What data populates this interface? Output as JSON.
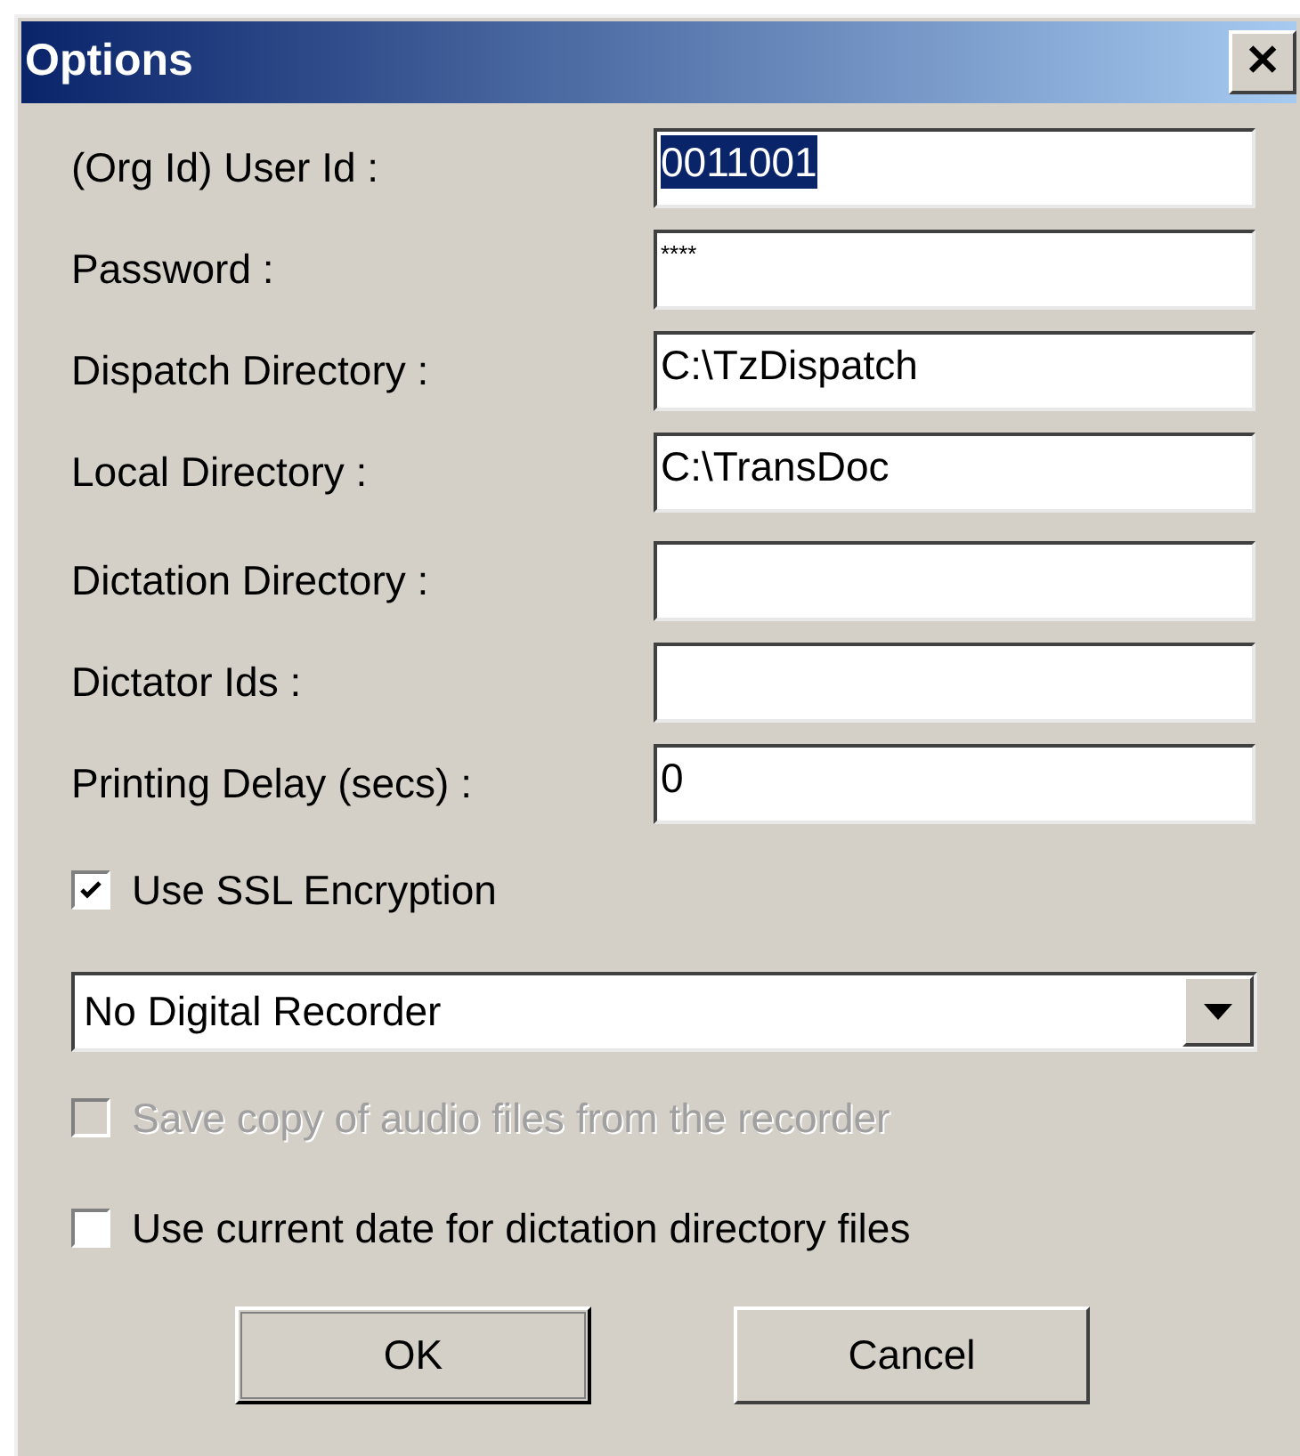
{
  "window": {
    "title": "Options",
    "close": "✕"
  },
  "fields": [
    {
      "label": "(Org Id) User Id :",
      "value": "0011001",
      "kind": "text",
      "text_selected": true
    },
    {
      "label": "Password :",
      "value": "****",
      "kind": "password",
      "text_selected": false
    },
    {
      "label": "Dispatch Directory :",
      "value": "C:\\TzDispatch",
      "kind": "text",
      "text_selected": false
    },
    {
      "label": "Local Directory :",
      "value": "C:\\TransDoc",
      "kind": "text",
      "text_selected": false
    },
    {
      "label": "Dictation Directory :",
      "kind": "text"
    },
    {
      "label": "Dictator Ids :",
      "kind": "text"
    },
    {
      "label": "Printing Delay (secs) :",
      "value": "0",
      "kind": "text",
      "text_selected": false
    }
  ],
  "ssl": {
    "label": "Use SSL Encryption",
    "checked": true,
    "disabled": false
  },
  "recorder": {
    "value": "No Digital Recorder"
  },
  "options": [
    {
      "label": "Save copy of audio files from the recorder",
      "checked": false,
      "disabled": true
    },
    {
      "label": "Use current date for dictation directory files",
      "checked": false,
      "disabled": false
    }
  ],
  "buttons": [
    "OK",
    "Cancel"
  ]
}
